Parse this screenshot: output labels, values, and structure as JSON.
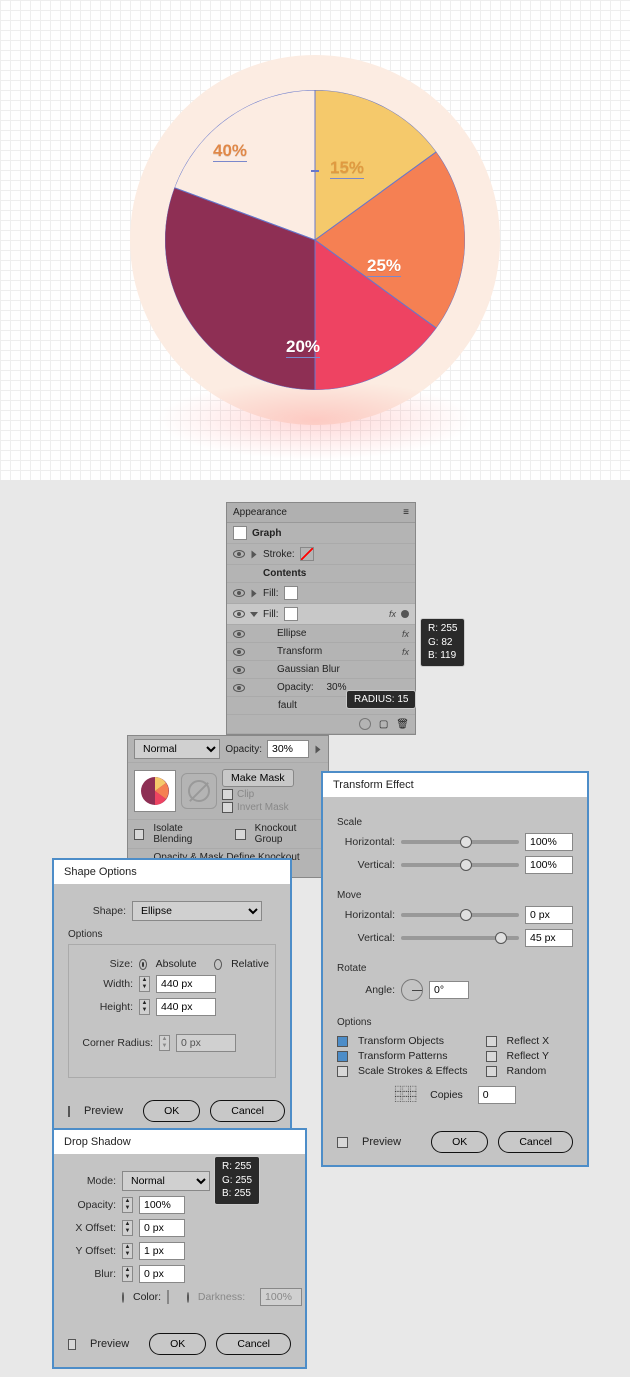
{
  "chart_data": {
    "type": "pie",
    "slices": [
      {
        "label": "40%",
        "value": 40,
        "color": "#8e2f54"
      },
      {
        "label": "15%",
        "value": 15,
        "color": "#f5c96b"
      },
      {
        "label": "25%",
        "value": 25,
        "color": "#f58053"
      },
      {
        "label": "20%",
        "value": 20,
        "color": "#ee4362"
      }
    ]
  },
  "appearance": {
    "panel_title": "Appearance",
    "graph_label": "Graph",
    "stroke_label": "Stroke:",
    "contents_label": "Contents",
    "fill_label": "Fill:",
    "ellipse_label": "Ellipse",
    "transform_label": "Transform",
    "gaussian_label": "Gaussian Blur",
    "opacity_row": "Opacity:",
    "opacity_value": "30%",
    "default_label": "fault",
    "rgb_r": "R: 255",
    "rgb_g": "G:   82",
    "rgb_b": "B: 119",
    "radius_tooltip": "RADIUS:  15",
    "fill_color": "#ee4362"
  },
  "transparency": {
    "blend_mode": "Normal",
    "opacity_label": "Opacity:",
    "opacity_value": "30%",
    "make_mask": "Make Mask",
    "clip": "Clip",
    "invert_mask": "Invert Mask",
    "isolate": "Isolate Blending",
    "knockout": "Knockout Group",
    "define_shape": "Opacity & Mask Define Knockout Shape"
  },
  "shape_options": {
    "title": "Shape Options",
    "shape_label": "Shape:",
    "shape_value": "Ellipse",
    "options_label": "Options",
    "size_label": "Size:",
    "absolute": "Absolute",
    "relative": "Relative",
    "width_label": "Width:",
    "width_value": "440 px",
    "height_label": "Height:",
    "height_value": "440 px",
    "corner_label": "Corner Radius:",
    "corner_value": "0 px",
    "preview": "Preview",
    "ok": "OK",
    "cancel": "Cancel"
  },
  "transform_effect": {
    "title": "Transform Effect",
    "scale": "Scale",
    "move": "Move",
    "rotate": "Rotate",
    "options": "Options",
    "horizontal": "Horizontal:",
    "vertical": "Vertical:",
    "angle": "Angle:",
    "angle_value": "0°",
    "scale_h": "100%",
    "scale_v": "100%",
    "move_h": "0 px",
    "move_v": "45 px",
    "transform_objects": "Transform Objects",
    "transform_patterns": "Transform Patterns",
    "scale_strokes": "Scale Strokes & Effects",
    "reflect_x": "Reflect X",
    "reflect_y": "Reflect Y",
    "random": "Random",
    "copies": "Copies",
    "copies_value": "0",
    "preview": "Preview",
    "ok": "OK",
    "cancel": "Cancel"
  },
  "drop_shadow": {
    "title": "Drop Shadow",
    "mode_label": "Mode:",
    "mode_value": "Normal",
    "opacity_label": "Opacity:",
    "opacity_value": "100%",
    "x_offset_label": "X Offset:",
    "x_offset_value": "0 px",
    "y_offset_label": "Y Offset:",
    "y_offset_value": "1 px",
    "blur_label": "Blur:",
    "blur_value": "0 px",
    "color_label": "Color:",
    "darkness_label": "Darkness:",
    "darkness_value": "100%",
    "rgb_r": "R: 255",
    "rgb_g": "G: 255",
    "rgb_b": "B: 255",
    "preview": "Preview",
    "ok": "OK",
    "cancel": "Cancel"
  }
}
